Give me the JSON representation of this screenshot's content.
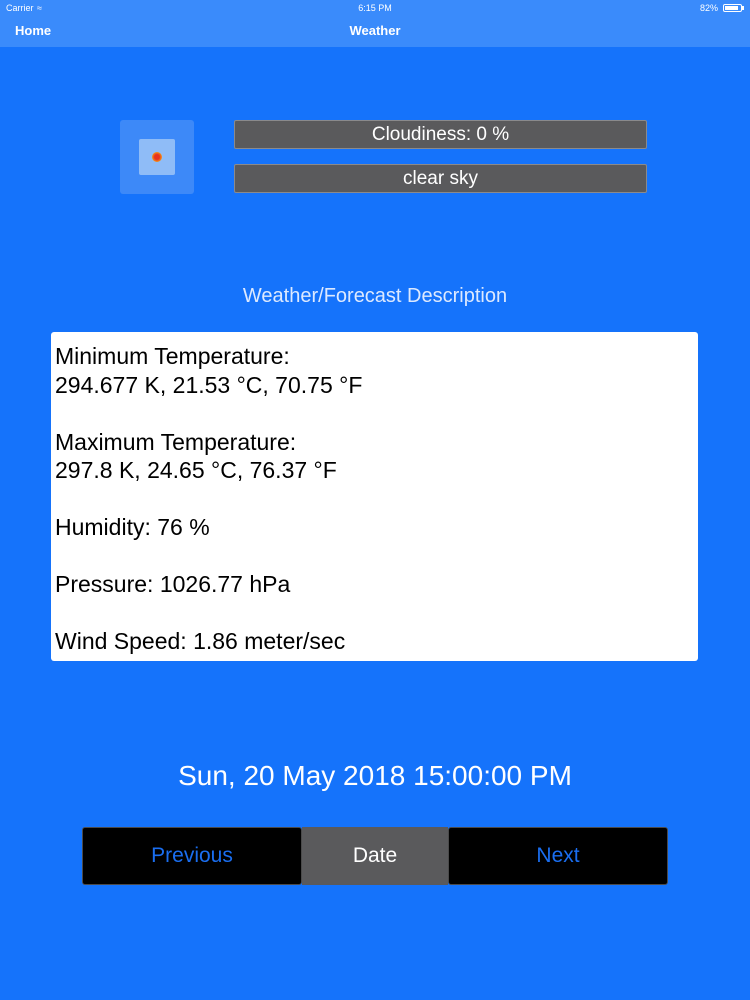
{
  "status_bar": {
    "carrier": "Carrier",
    "wifi_icon": "wifi-icon",
    "time": "6:15 PM",
    "battery_percent": "82%",
    "battery_level": 0.82
  },
  "nav_bar": {
    "back_label": "Home",
    "title": "Weather"
  },
  "weather": {
    "icon": "clear-sky-sun-icon",
    "cloudiness": "Cloudiness: 0 %",
    "description": "clear sky"
  },
  "details": {
    "heading": "Weather/Forecast Description",
    "min_temp_label": "Minimum Temperature:",
    "min_temp_value": "294.677 K, 21.53 °C, 70.75 °F",
    "max_temp_label": "Maximum Temperature:",
    "max_temp_value": "297.8 K, 24.65 °C, 76.37 °F",
    "humidity": "Humidity: 76 %",
    "pressure": "Pressure: 1026.77 hPa",
    "wind_speed": "Wind Speed: 1.86 meter/sec"
  },
  "date_display": "Sun, 20 May 2018 15:00:00 PM",
  "controls": {
    "previous_label": "Previous",
    "date_label": "Date",
    "next_label": "Next"
  },
  "colors": {
    "background": "#1573fb",
    "bar_background": "#3a8bfb",
    "button_text": "#1a6ef0",
    "gray_panel": "#5a5a5c"
  }
}
